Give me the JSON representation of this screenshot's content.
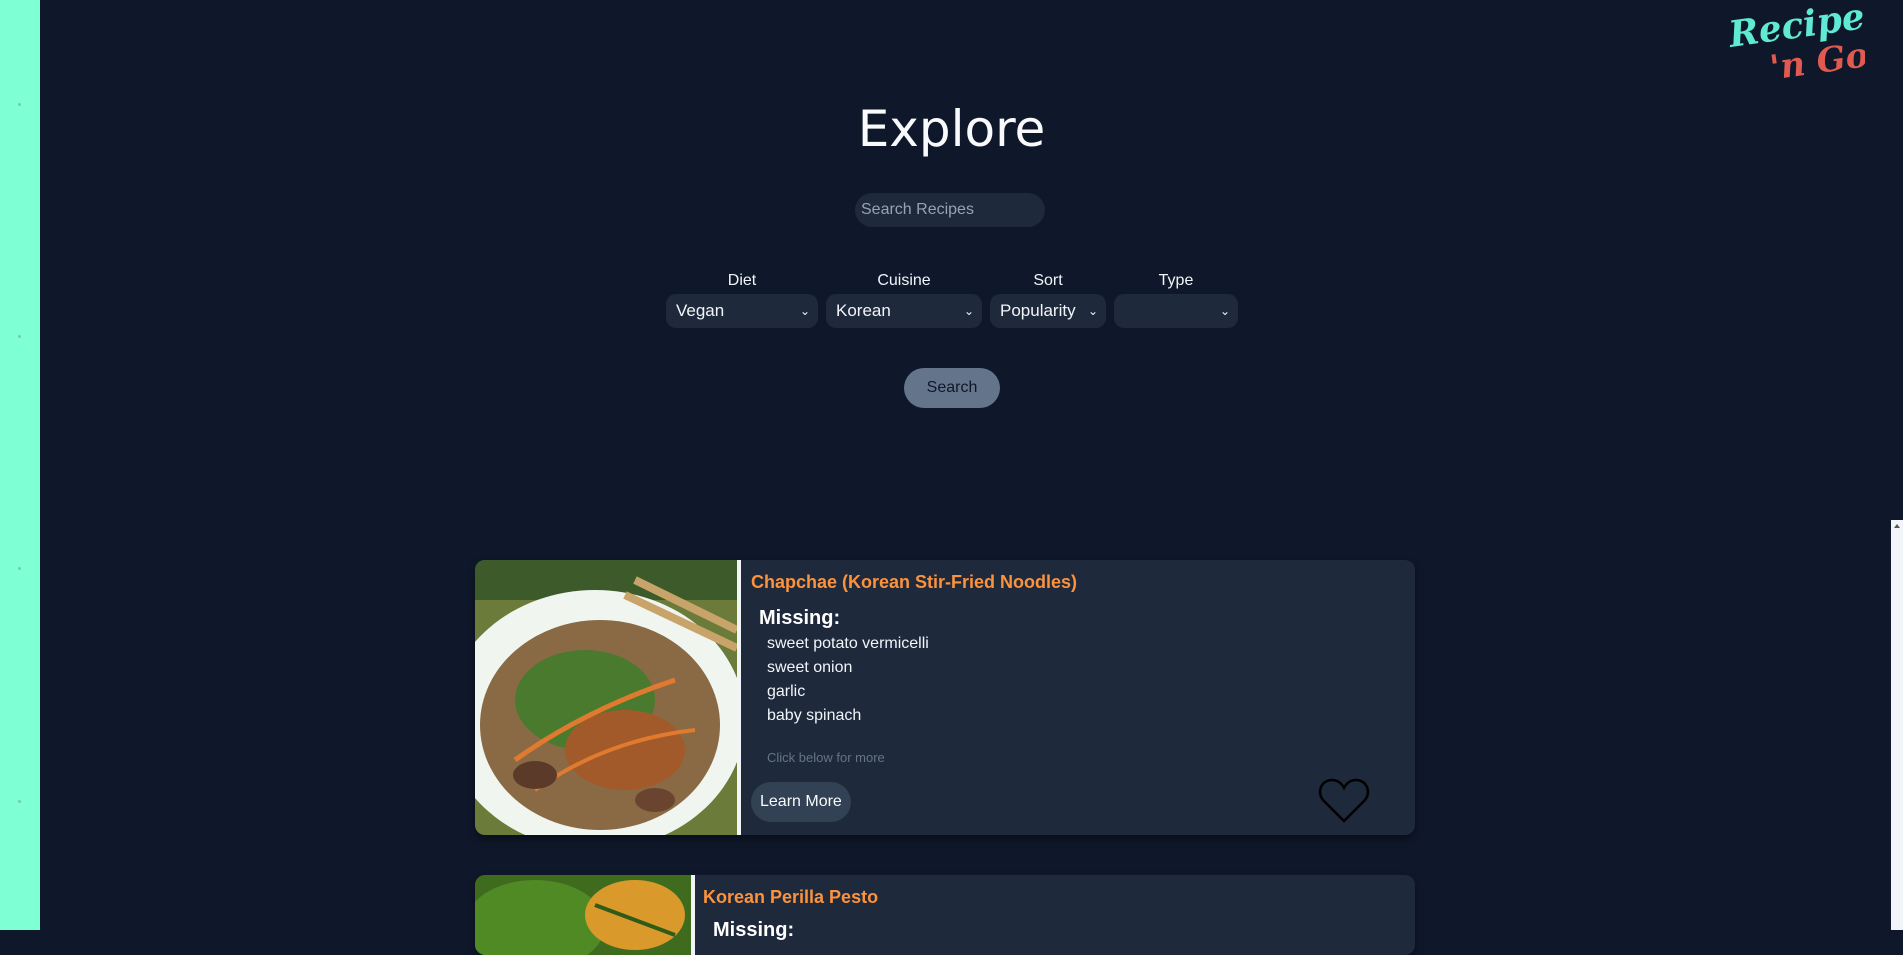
{
  "logo": {
    "line1": "Recipe",
    "line2": "'n Go"
  },
  "page": {
    "title": "Explore"
  },
  "search": {
    "placeholder": "Search Recipes",
    "button": "Search"
  },
  "filters": [
    {
      "label": "Diet",
      "value": "Vegan"
    },
    {
      "label": "Cuisine",
      "value": "Korean"
    },
    {
      "label": "Sort",
      "value": "Popularity"
    },
    {
      "label": "Type",
      "value": ""
    }
  ],
  "recipes": [
    {
      "title": "Chapchae (Korean Stir-Fried Noodles)",
      "missing_label": "Missing:",
      "missing": [
        "sweet potato vermicelli",
        "sweet onion",
        "garlic",
        "baby spinach"
      ],
      "hint": "Click below for more",
      "button": "Learn More"
    },
    {
      "title": "Korean Perilla Pesto",
      "missing_label": "Missing:"
    }
  ],
  "colors": {
    "background": "#0f172a",
    "sidebar": "#7fffd4",
    "card": "#1e293b",
    "title_accent": "#fb923c"
  }
}
